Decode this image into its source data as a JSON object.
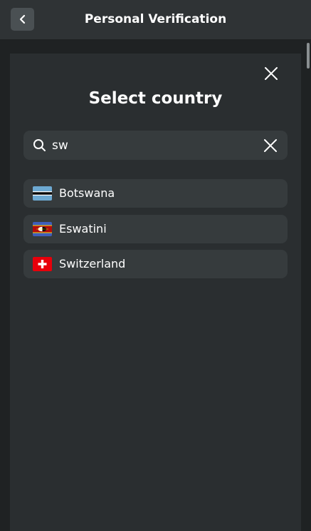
{
  "header": {
    "title": "Personal Verification",
    "back_icon": "chevron-left-icon"
  },
  "modal": {
    "title": "Select country",
    "close_icon": "close-icon"
  },
  "search": {
    "value": "sw",
    "icon": "search-icon",
    "clear_icon": "clear-icon"
  },
  "countries": [
    {
      "name": "Botswana",
      "flag": "botswana-flag-icon"
    },
    {
      "name": "Eswatini",
      "flag": "eswatini-flag-icon"
    },
    {
      "name": "Switzerland",
      "flag": "switzerland-flag-icon"
    }
  ],
  "colors": {
    "page_background": "#1f2223",
    "header_background": "#2f3335",
    "modal_background": "#2a2e30",
    "field_background": "#363b3d",
    "text": "#ffffff"
  }
}
